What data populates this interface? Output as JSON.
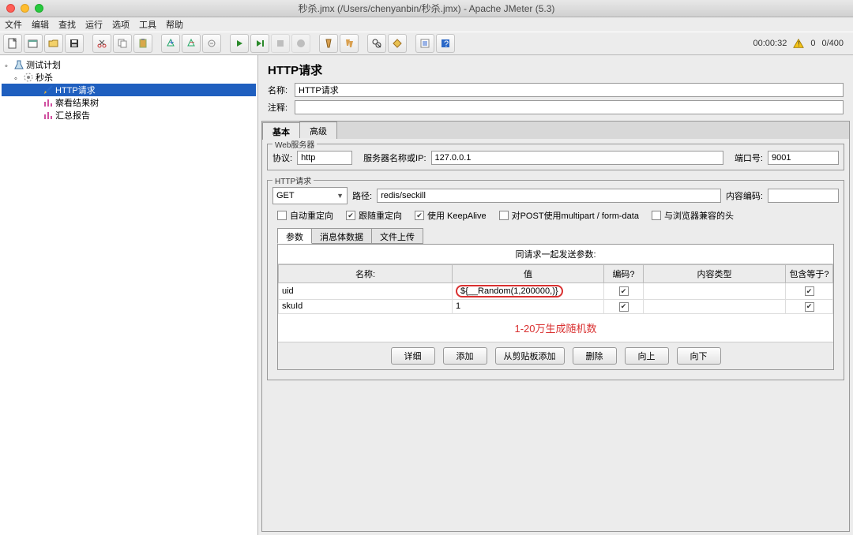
{
  "window": {
    "title": "秒杀.jmx (/Users/chenyanbin/秒杀.jmx) - Apache JMeter (5.3)"
  },
  "menu": {
    "file": "文件",
    "edit": "编辑",
    "search": "查找",
    "run": "运行",
    "options": "选项",
    "tools": "工具",
    "help": "帮助"
  },
  "status": {
    "time": "00:00:32",
    "errors": "0",
    "threads": "0/400"
  },
  "tree": {
    "root": "测试计划",
    "group": "秒杀",
    "http": "HTTP请求",
    "viewResults": "察看结果树",
    "summary": "汇总报告"
  },
  "panel": {
    "title": "HTTP请求",
    "name_label": "名称:",
    "name_value": "HTTP请求",
    "comment_label": "注释:",
    "tabs": {
      "basic": "基本",
      "advanced": "高级"
    }
  },
  "webserver": {
    "legend": "Web服务器",
    "protocol_label": "协议:",
    "protocol_value": "http",
    "server_label": "服务器名称或IP:",
    "server_value": "127.0.0.1",
    "port_label": "端口号:",
    "port_value": "9001"
  },
  "httpreq": {
    "legend": "HTTP请求",
    "method": "GET",
    "path_label": "路径:",
    "path_value": "redis/seckill",
    "encoding_label": "内容编码:",
    "encoding_value": ""
  },
  "options": {
    "auto_redirect": "自动重定向",
    "follow_redirect": "跟随重定向",
    "keepalive": "使用 KeepAlive",
    "multipart": "对POST使用multipart / form-data",
    "browser_compat": "与浏览器兼容的头"
  },
  "inner_tabs": {
    "params": "参数",
    "body": "消息体数据",
    "files": "文件上传"
  },
  "params": {
    "header_text": "同请求一起发送参数:",
    "cols": {
      "name": "名称:",
      "value": "值",
      "encode": "编码?",
      "ctype": "内容类型",
      "include": "包含等于?"
    },
    "rows": [
      {
        "name": "uid",
        "value": "${__Random(1,200000,)}",
        "encode": true,
        "ctype": "",
        "include": true
      },
      {
        "name": "skuId",
        "value": "1",
        "encode": true,
        "ctype": "",
        "include": true
      }
    ]
  },
  "annotation": "1-20万生成随机数",
  "buttons": {
    "detail": "详细",
    "add": "添加",
    "clipboard": "从剪贴板添加",
    "delete": "删除",
    "up": "向上",
    "down": "向下"
  }
}
